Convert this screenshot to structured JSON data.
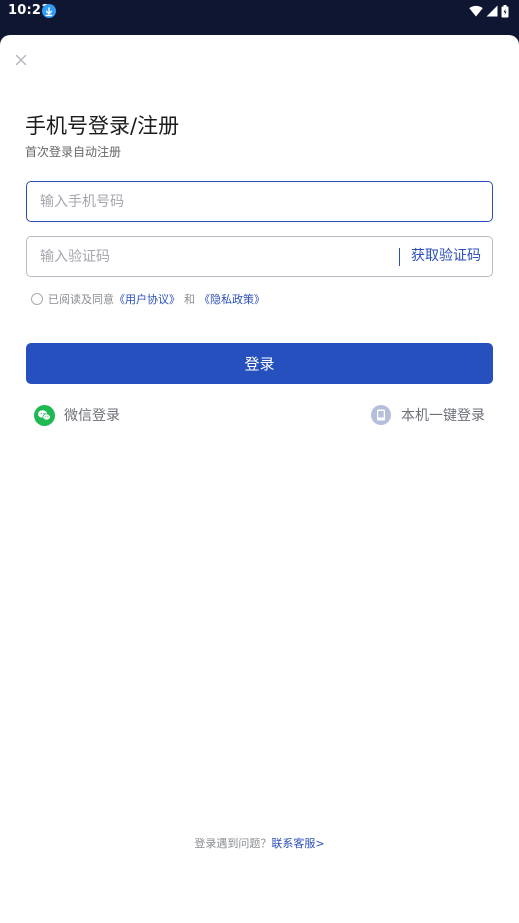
{
  "status_bar": {
    "time": "10:21",
    "icons": [
      "download-icon",
      "wifi-icon",
      "signal-icon",
      "battery-icon"
    ]
  },
  "colors": {
    "accent": "#2650bd",
    "link": "#2a4fb9",
    "status_bar_bg": "#0f1631",
    "wechat_green": "#1fb954"
  },
  "header": {
    "close_icon": "close-icon",
    "title": "手机号登录/注册",
    "subtitle": "首次登录自动注册"
  },
  "form": {
    "phone_placeholder": "输入手机号码",
    "phone_value": "",
    "code_placeholder": "输入验证码",
    "code_value": "",
    "get_code_label": "获取验证码"
  },
  "agreement": {
    "checked": false,
    "prefix": "已阅读及同意",
    "user_agreement": "《用户协议》",
    "and": "和",
    "privacy_policy": "《隐私政策》"
  },
  "login_button": {
    "label": "登录"
  },
  "alt_login": {
    "wechat_label": "微信登录",
    "local_label": "本机一键登录"
  },
  "help": {
    "question": "登录遇到问题？",
    "contact": "联系客服>"
  }
}
